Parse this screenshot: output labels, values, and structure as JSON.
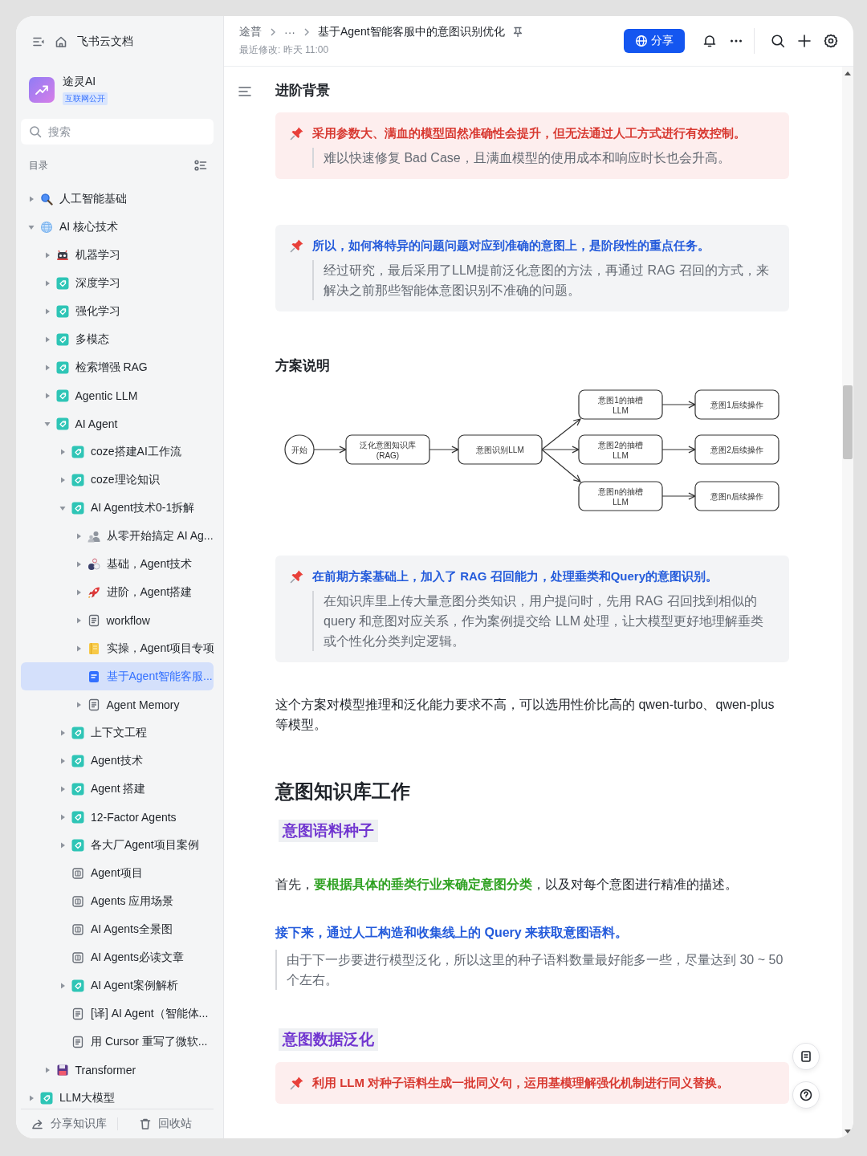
{
  "sidebar": {
    "app_title": "飞书云文档",
    "workspace": {
      "name": "途灵AI",
      "badge": "互联网公开"
    },
    "search": {
      "placeholder": "搜索"
    },
    "toc_label": "目录",
    "tree": [
      {
        "label": "人工智能基础",
        "kind": "magnifier",
        "expanded": false,
        "selected": false
      },
      {
        "label": "AI 核心技术",
        "kind": "globe",
        "expanded": true,
        "selected": false,
        "children": [
          {
            "label": "机器学习",
            "kind": "robot",
            "expanded": false,
            "selected": false
          },
          {
            "label": "深度学习",
            "kind": "tag",
            "expanded": false,
            "selected": false
          },
          {
            "label": "强化学习",
            "kind": "tag",
            "expanded": false,
            "selected": false
          },
          {
            "label": "多模态",
            "kind": "tag",
            "expanded": false,
            "selected": false
          },
          {
            "label": "检索增强 RAG",
            "kind": "tag",
            "expanded": false,
            "selected": false
          },
          {
            "label": "Agentic LLM",
            "kind": "tag",
            "expanded": false,
            "selected": false
          },
          {
            "label": "AI Agent",
            "kind": "tag",
            "expanded": true,
            "selected": false,
            "children": [
              {
                "label": "coze搭建AI工作流",
                "kind": "tag",
                "expanded": false,
                "selected": false
              },
              {
                "label": "coze理论知识",
                "kind": "tag",
                "expanded": false,
                "selected": false
              },
              {
                "label": "AI Agent技术0-1拆解",
                "kind": "tag",
                "expanded": true,
                "selected": false,
                "children": [
                  {
                    "label": "从零开始搞定 AI Ag...",
                    "kind": "people",
                    "expanded": false,
                    "selected": false
                  },
                  {
                    "label": "基础，Agent技术",
                    "kind": "balls",
                    "expanded": false,
                    "selected": false
                  },
                  {
                    "label": "进阶，Agent搭建",
                    "kind": "rocket",
                    "expanded": false,
                    "selected": false
                  },
                  {
                    "label": "workflow",
                    "kind": "doc",
                    "expanded": false,
                    "selected": false
                  },
                  {
                    "label": "实操，Agent项目专项",
                    "kind": "notebook",
                    "expanded": false,
                    "selected": false
                  },
                  {
                    "label": "基于Agent智能客服...",
                    "kind": "bluedoc",
                    "selected": true
                  },
                  {
                    "label": "Agent Memory",
                    "kind": "doc",
                    "expanded": false,
                    "selected": false
                  }
                ]
              },
              {
                "label": "上下文工程",
                "kind": "tag",
                "expanded": false,
                "selected": false
              },
              {
                "label": "Agent技术",
                "kind": "tag",
                "expanded": false,
                "selected": false
              },
              {
                "label": "Agent 搭建",
                "kind": "tag",
                "expanded": false,
                "selected": false
              },
              {
                "label": "12-Factor Agents",
                "kind": "tag",
                "expanded": false,
                "selected": false
              },
              {
                "label": "各大厂Agent项目案例",
                "kind": "tag",
                "expanded": false,
                "selected": false
              },
              {
                "label": "Agent项目",
                "kind": "board",
                "selected": false
              },
              {
                "label": "Agents 应用场景",
                "kind": "board",
                "selected": false
              },
              {
                "label": "AI Agents全景图",
                "kind": "board",
                "selected": false
              },
              {
                "label": "AI Agents必读文章",
                "kind": "board",
                "selected": false
              },
              {
                "label": "AI Agent案例解析",
                "kind": "tag",
                "expanded": false,
                "selected": false
              },
              {
                "label": "[译] AI Agent（智能体...",
                "kind": "doc",
                "selected": false
              },
              {
                "label": "用 Cursor 重写了微软...",
                "kind": "doc",
                "selected": false
              }
            ]
          },
          {
            "label": "Transformer",
            "kind": "floppy",
            "expanded": false,
            "selected": false
          }
        ]
      },
      {
        "label": "LLM大模型",
        "kind": "tag",
        "expanded": false,
        "selected": false
      }
    ],
    "footer": [
      {
        "kind": "share",
        "label": "分享知识库"
      },
      {
        "kind": "trash",
        "label": "回收站"
      }
    ]
  },
  "topbar": {
    "breadcrumb": [
      "途普",
      "···",
      "基于Agent智能客服中的意图识别优化"
    ],
    "modified": "最近修改: 昨天 11:00",
    "share_button": "分享"
  },
  "document": {
    "blocks": [
      {
        "kind": "heading",
        "text": "进阶背景"
      },
      {
        "kind": "warning",
        "title": "采用参数大、满血的模型固然准确性会提升，但无法通过人工方式进行有效控制。",
        "body": "难以快速修复 Bad Case，且满血模型的使用成本和响应时长也会升高。"
      },
      {
        "kind": "note",
        "title": "所以，如何将特异的问题问题对应到准确的意图上，是阶段性的重点任务。",
        "body": "经过研究，最后采用了LLM提前泛化意图的方法，再通过 RAG 召回的方式，来解决之前那些智能体意图识别不准确的问题。"
      },
      {
        "kind": "heading",
        "text": "方案说明"
      },
      {
        "kind": "diagram",
        "nodes": [
          {
            "kind": "circle",
            "lines": [
              "开始"
            ]
          },
          {
            "kind": "box",
            "lines": [
              "泛化意图知识库",
              "(RAG)"
            ]
          },
          {
            "kind": "box",
            "lines": [
              "意图识别LLM"
            ]
          },
          {
            "kind": "box",
            "lines": [
              "意图1的抽槽",
              "LLM"
            ]
          },
          {
            "kind": "box",
            "lines": [
              "意图2的抽槽",
              "LLM"
            ]
          },
          {
            "kind": "box",
            "lines": [
              "意图n的抽槽",
              "LLM"
            ]
          },
          {
            "kind": "box",
            "lines": [
              "意图1后续操作"
            ]
          },
          {
            "kind": "box",
            "lines": [
              "意图2后续操作"
            ]
          },
          {
            "kind": "box",
            "lines": [
              "意图n后续操作"
            ]
          }
        ]
      },
      {
        "kind": "note",
        "title": "在前期方案基础上，加入了 RAG 召回能力，处理垂类和Query的意图识别。",
        "body": "在知识库里上传大量意图分类知识，用户提问时，先用 RAG 召回找到相似的 query 和意图对应关系，作为案例提交给 LLM 处理，让大模型更好地理解垂类或个性化分类判定逻辑。"
      },
      {
        "kind": "paragraph",
        "text": "这个方案对模型推理和泛化能力要求不高，可以选用性价比高的 qwen-turbo、qwen-plus 等模型。"
      },
      {
        "kind": "title",
        "text": "意图知识库工作"
      },
      {
        "kind": "highlight",
        "text": "意图语料种子"
      },
      {
        "kind": "paragraph",
        "text": "首先，**要根据具体的垂类行业来确定意图分类**，以及对每个意图进行精准的描述。"
      },
      {
        "kind": "emphasis",
        "text": "接下来，通过人工构造和收集线上的 Query 来获取意图语料。"
      },
      {
        "kind": "quote",
        "text": "由于下一步要进行模型泛化，所以这里的种子语料数量最好能多一些，尽量达到 30 ~ 50 个左右。"
      },
      {
        "kind": "highlight",
        "text": "意图数据泛化"
      },
      {
        "kind": "warning",
        "title": "利用 LLM 对种子语料生成一批同义句，运用基模理解强化机制进行同义替换。"
      }
    ]
  }
}
